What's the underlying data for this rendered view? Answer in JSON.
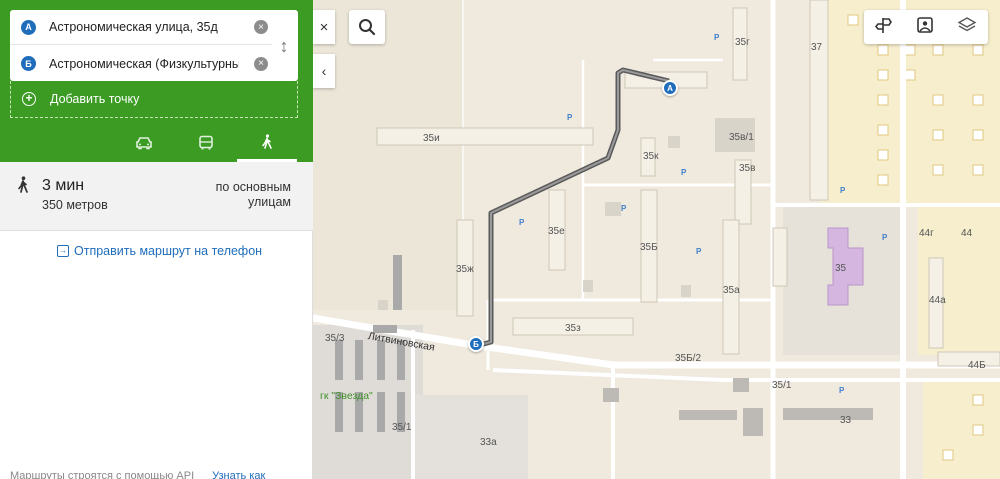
{
  "route": {
    "from": {
      "marker": "А",
      "address": "Астрономическая улица, 35д"
    },
    "to": {
      "marker": "Б",
      "address": "Астрономическая (Физкультурный"
    },
    "add_point": "Добавить точку",
    "modes": [
      "car",
      "bus",
      "walk"
    ],
    "active_mode": "walk"
  },
  "result": {
    "duration": "3 мин",
    "distance": "350 метров",
    "road_type": "по основным улицам"
  },
  "send_to_phone": "Отправить маршрут на телефон",
  "footer": {
    "text": "Маршруты строятся с помощью API",
    "link": "Узнать как"
  },
  "map": {
    "labels": {
      "b35g": "35г",
      "b37": "37",
      "b35i": "35и",
      "b35v1": "35в/1",
      "b35k": "35к",
      "b35v": "35в",
      "b35e": "35е",
      "b35b": "35Б",
      "b35zh": "35ж",
      "b35a": "35а",
      "b35": "35",
      "b44g": "44г",
      "b44": "44",
      "b44a": "44а",
      "b35z": "35з",
      "b35_3": "35/3",
      "b35b2": "35Б/2",
      "b35_1a": "35/1",
      "b44b": "44Б",
      "b33": "33",
      "b35_1": "35/1",
      "b33a": "33а"
    },
    "street": "Литвиновская",
    "garage": "гк \"Звезда\"",
    "parking": "P",
    "marker_a": "A",
    "marker_b": "Б"
  },
  "controls": {
    "close_icon": "×",
    "collapse_icon": "‹"
  },
  "colors": {
    "accent_green": "#3b9b23",
    "link_blue": "#1f6dbb",
    "route_line": "#555555"
  }
}
